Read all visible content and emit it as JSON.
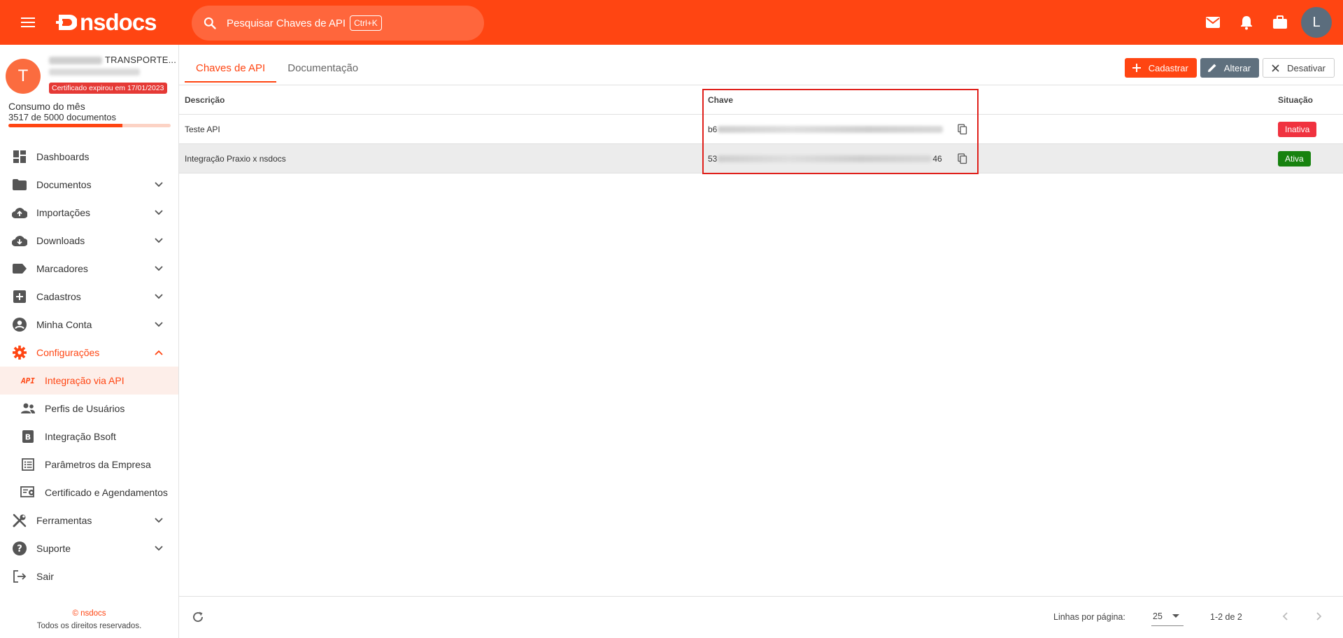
{
  "brand": {
    "name": "nsdocs"
  },
  "search": {
    "placeholder": "Pesquisar Chaves de API",
    "shortcut": "Ctrl+K"
  },
  "user": {
    "initial": "L"
  },
  "company": {
    "initial": "T",
    "name": "TRANSPORTE...",
    "certificate_badge": "Certificado expirou em 17/01/2023"
  },
  "consumo": {
    "title": "Consumo do mês",
    "count": "3517 de 5000 documentos",
    "used": 3517,
    "total": 5000
  },
  "sidebar": {
    "items": [
      {
        "label": "Dashboards",
        "icon": "dashboard-icon"
      },
      {
        "label": "Documentos",
        "icon": "folder-icon"
      },
      {
        "label": "Importações",
        "icon": "cloud-upload-icon"
      },
      {
        "label": "Downloads",
        "icon": "cloud-download-icon"
      },
      {
        "label": "Marcadores",
        "icon": "label-icon"
      },
      {
        "label": "Cadastros",
        "icon": "add-box-icon"
      },
      {
        "label": "Minha Conta",
        "icon": "account-circle-icon"
      },
      {
        "label": "Configurações",
        "icon": "gear-icon"
      }
    ],
    "sub_items": [
      {
        "label": "Integração via API",
        "icon": "API"
      },
      {
        "label": "Perfis de Usuários",
        "icon": "people-icon"
      },
      {
        "label": "Integração Bsoft",
        "icon": "bsoft-icon"
      },
      {
        "label": "Parâmetros da Empresa",
        "icon": "list-icon"
      },
      {
        "label": "Certificado e Agendamentos",
        "icon": "certificate-icon"
      }
    ],
    "bottom_items": [
      {
        "label": "Ferramentas",
        "icon": "tools-icon"
      },
      {
        "label": "Suporte",
        "icon": "help-icon"
      },
      {
        "label": "Sair",
        "icon": "logout-icon"
      }
    ]
  },
  "footer": {
    "copy": "© nsdocs",
    "rights": "Todos os direitos reservados."
  },
  "tabs": [
    "Chaves de API",
    "Documentação"
  ],
  "actions": {
    "cadastrar": "Cadastrar",
    "alterar": "Alterar",
    "desativar": "Desativar"
  },
  "table": {
    "headers": {
      "descricao": "Descrição",
      "chave": "Chave",
      "situacao": "Situação"
    },
    "rows": [
      {
        "descricao": "Teste API",
        "chave_prefix": "b6",
        "chave_suffix": "",
        "situacao": "Inativa"
      },
      {
        "descricao": "Integração Praxio x nsdocs",
        "chave_prefix": "53",
        "chave_suffix": "46",
        "situacao": "Ativa"
      }
    ]
  },
  "pager": {
    "rows_label": "Linhas por página:",
    "rows_value": "25",
    "range": "1-2 de 2"
  },
  "colors": {
    "brand": "#ff4512",
    "inactive": "#f0323f",
    "active": "#17820f",
    "highlight_box": "#e0201b"
  }
}
